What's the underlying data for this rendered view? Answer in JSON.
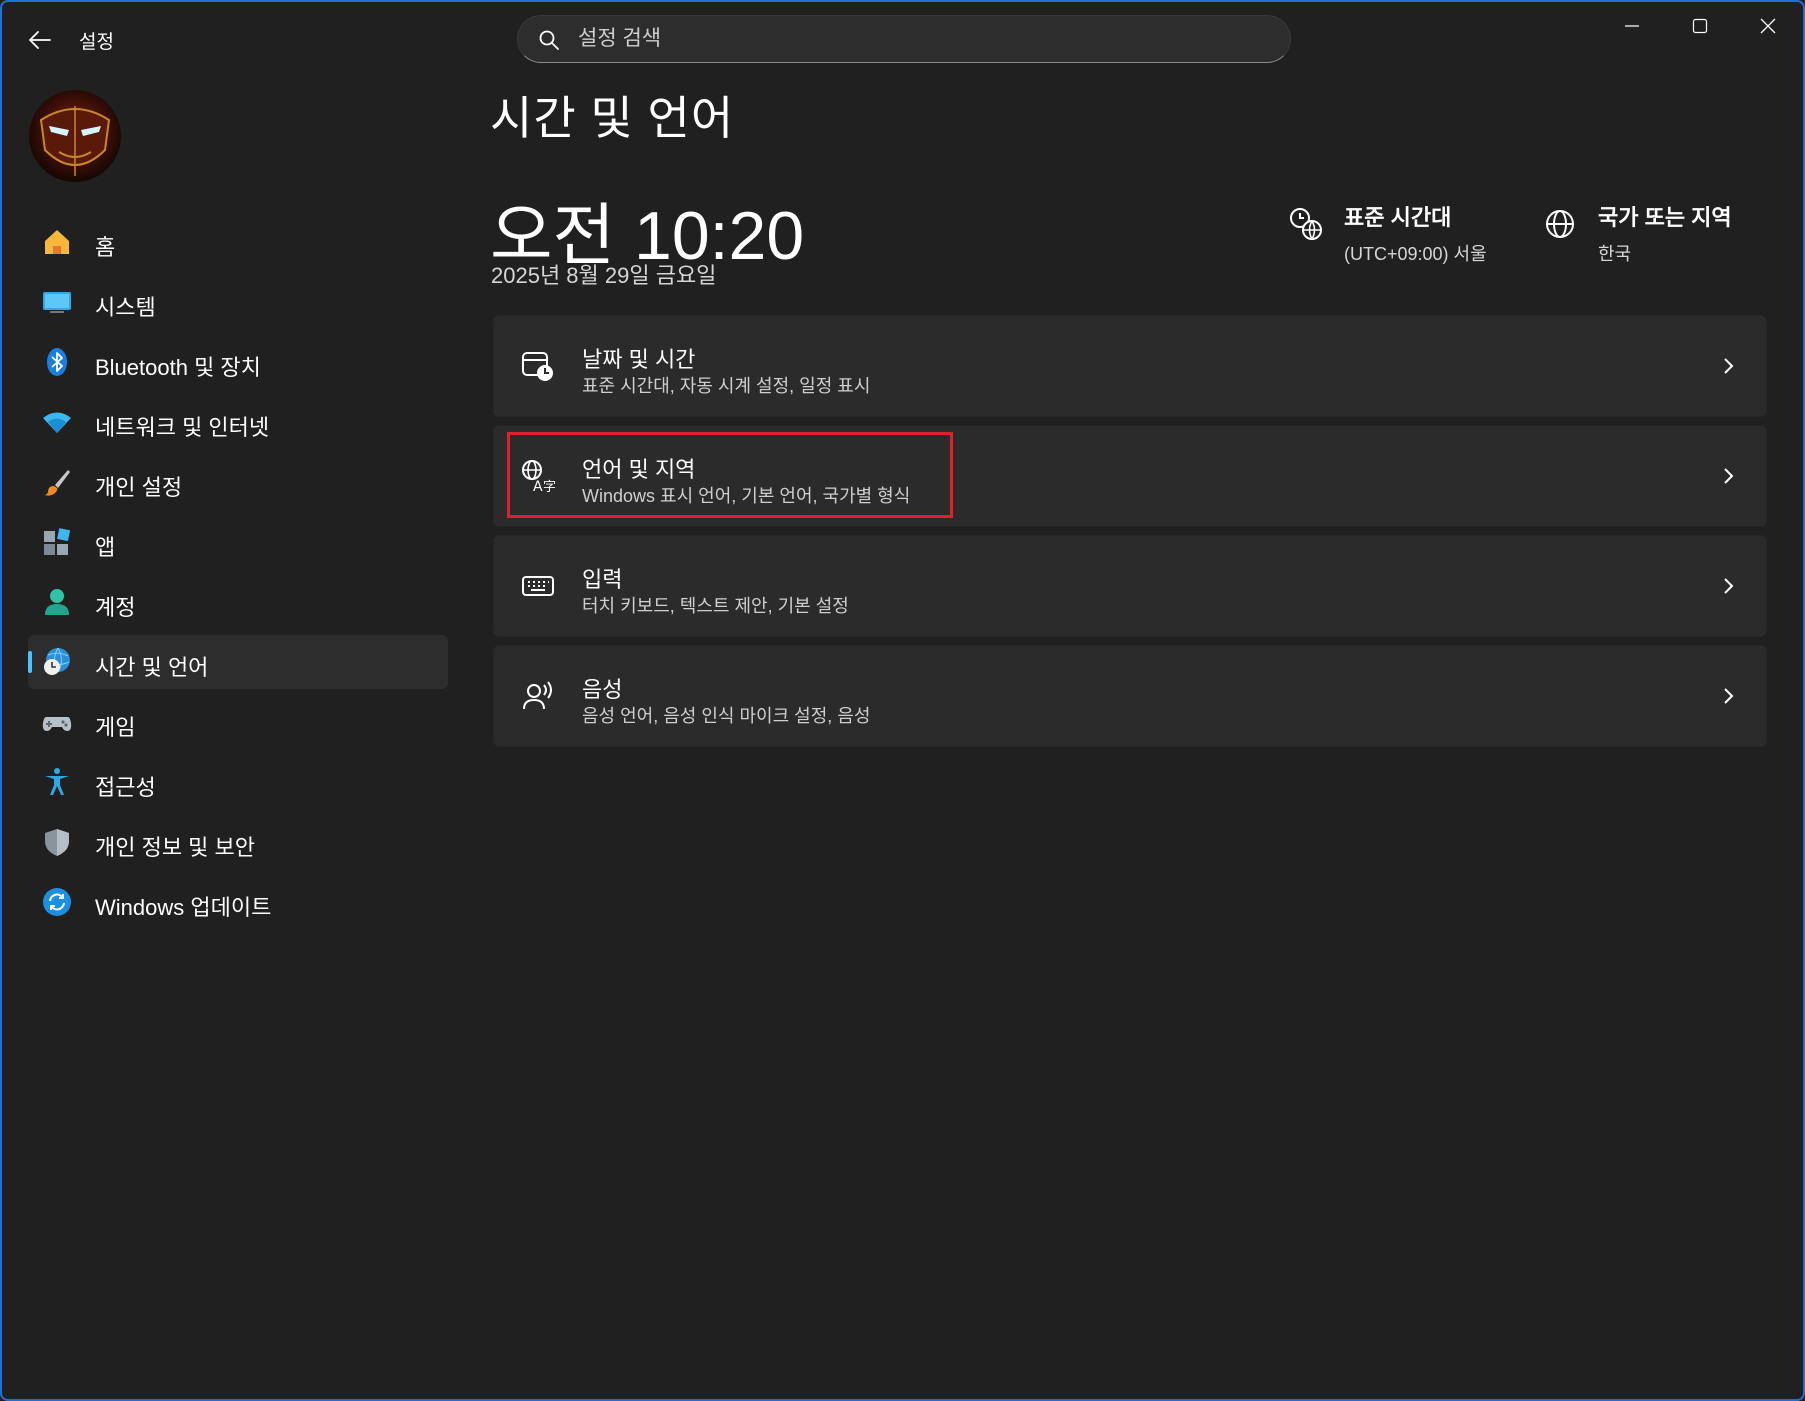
{
  "titlebar": {
    "app_title": "설정",
    "search_placeholder": "설정 검색"
  },
  "sidebar": {
    "items": [
      {
        "label": "홈",
        "icon": "home-icon"
      },
      {
        "label": "시스템",
        "icon": "system-icon"
      },
      {
        "label": "Bluetooth 및 장치",
        "icon": "bluetooth-icon"
      },
      {
        "label": "네트워크 및 인터넷",
        "icon": "wifi-icon"
      },
      {
        "label": "개인 설정",
        "icon": "brush-icon"
      },
      {
        "label": "앱",
        "icon": "apps-icon"
      },
      {
        "label": "계정",
        "icon": "account-icon"
      },
      {
        "label": "시간 및 언어",
        "icon": "time-language-icon",
        "active": true
      },
      {
        "label": "게임",
        "icon": "gamepad-icon"
      },
      {
        "label": "접근성",
        "icon": "accessibility-icon"
      },
      {
        "label": "개인 정보 및 보안",
        "icon": "shield-icon"
      },
      {
        "label": "Windows 업데이트",
        "icon": "update-icon"
      }
    ]
  },
  "main": {
    "page_title": "시간 및 언어",
    "clock": "오전 10:20",
    "date": "2025년 8월 29일 금요일",
    "timezone": {
      "title": "표준 시간대",
      "value": "(UTC+09:00) 서울"
    },
    "region": {
      "title": "국가 또는 지역",
      "value": "한국"
    },
    "cards": [
      {
        "title": "날짜 및 시간",
        "subtitle": "표준 시간대, 자동 시계 설정, 일정 표시",
        "icon": "date-time-icon"
      },
      {
        "title": "언어 및 지역",
        "subtitle": "Windows 표시 언어, 기본 언어, 국가별 형식",
        "icon": "language-icon",
        "highlighted": true
      },
      {
        "title": "입력",
        "subtitle": "터치 키보드, 텍스트 제안, 기본 설정",
        "icon": "keyboard-icon"
      },
      {
        "title": "음성",
        "subtitle": "음성 언어, 음성 인식 마이크 설정, 음성",
        "icon": "speech-icon"
      }
    ]
  },
  "colors": {
    "background": "#202020",
    "card": "#2b2b2b",
    "accent": "#4cc2ff",
    "highlight_box": "#e0202a",
    "window_border": "#1f6fd6"
  }
}
